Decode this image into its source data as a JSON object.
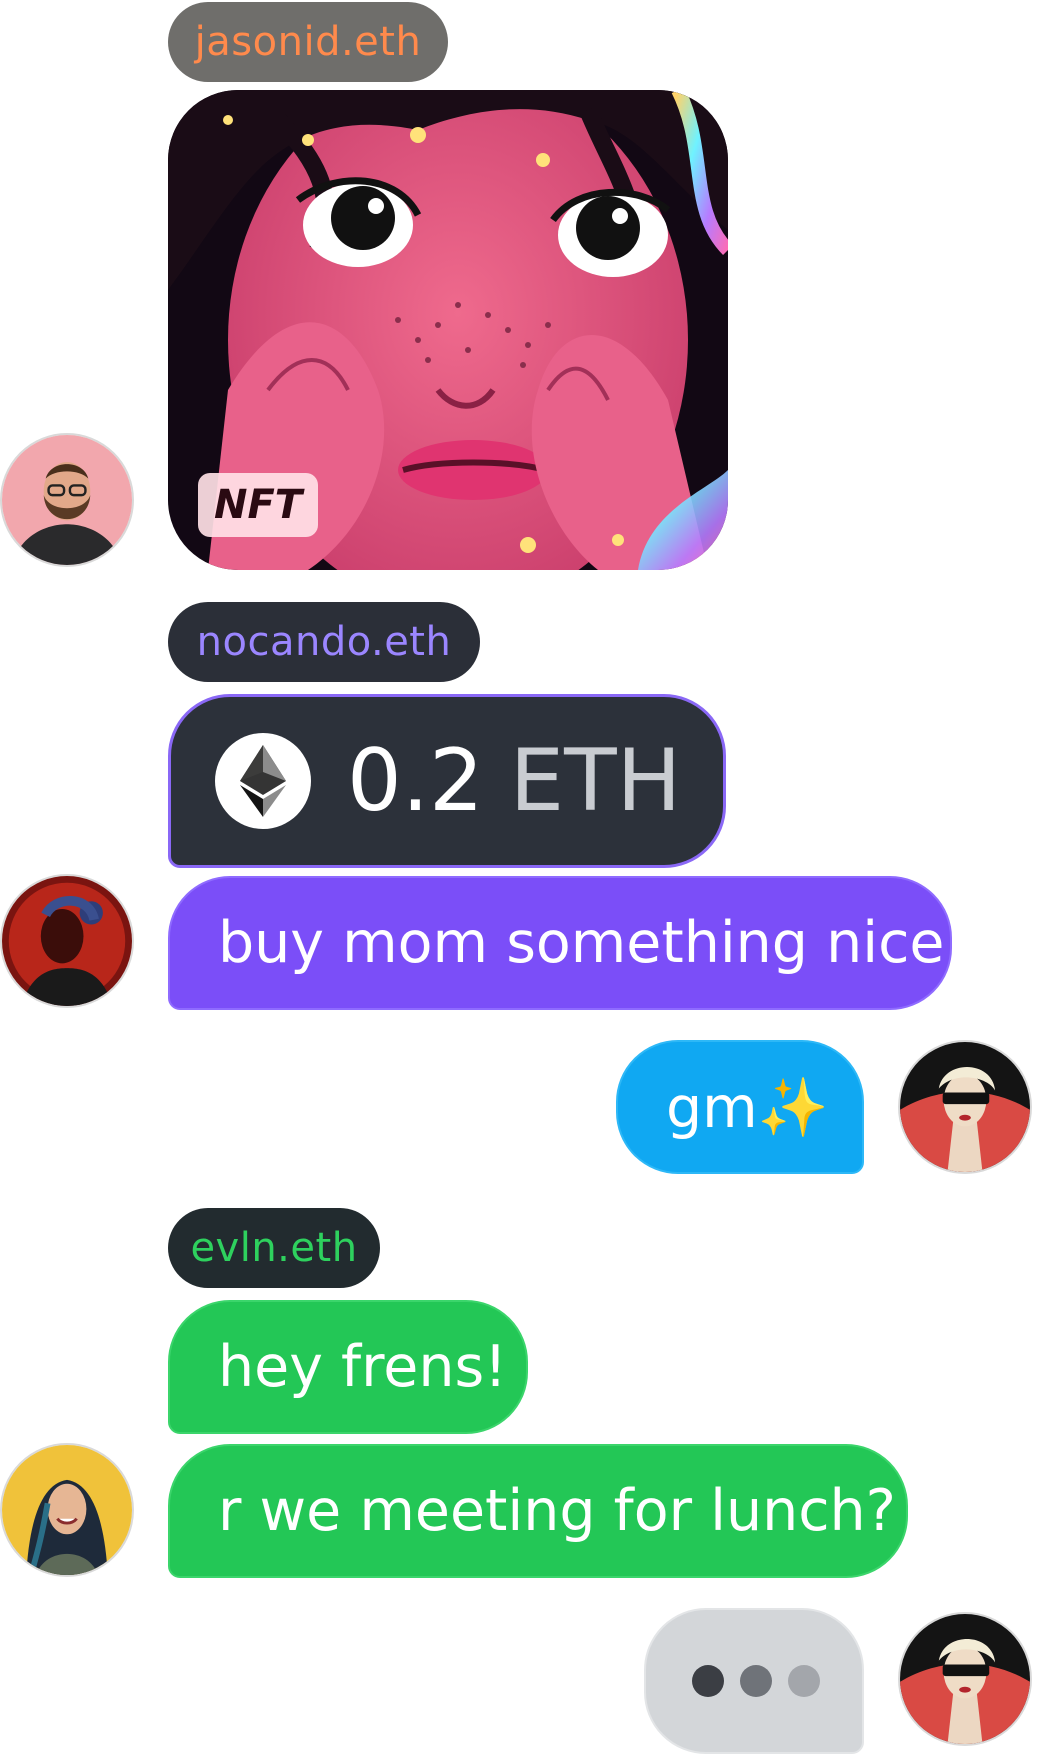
{
  "colors": {
    "jasonid_tag_bg": "#6f6e6b",
    "jasonid_tag_text": "#ff8a4c",
    "nocando_tag_bg": "#2b2f38",
    "nocando_tag_text": "#9b86ff",
    "evln_tag_bg": "#222b2f",
    "evln_tag_text": "#2ed15e",
    "eth_bubble_bg": "#2c313a",
    "eth_bubble_border": "#8a68f6",
    "purple_bubble": "#7b4ef8",
    "blue_bubble": "#10a8f2",
    "green_bubble": "#23c756",
    "typing_bubble": "#d3d6d9"
  },
  "messages": [
    {
      "sender": "jasonid.eth",
      "type": "nft",
      "badge": "NFT",
      "avatar_icon": "bearded-man-avatar"
    },
    {
      "sender": "nocando.eth",
      "type": "payment",
      "amount": "0.2",
      "currency": "ETH",
      "currency_icon": "ethereum-icon",
      "avatar_icon": "red-lit-person-avatar"
    },
    {
      "sender": "nocando.eth",
      "type": "text",
      "text": "buy mom something nice"
    },
    {
      "sender": "me",
      "type": "text",
      "text": "gm✨",
      "avatar_icon": "masked-woman-avatar"
    },
    {
      "sender": "evln.eth",
      "type": "text",
      "text": "hey frens!"
    },
    {
      "sender": "evln.eth",
      "type": "text",
      "text": "r we meeting for lunch?",
      "avatar_icon": "smiling-woman-avatar"
    },
    {
      "sender": "me",
      "type": "typing",
      "avatar_icon": "masked-woman-avatar"
    }
  ]
}
